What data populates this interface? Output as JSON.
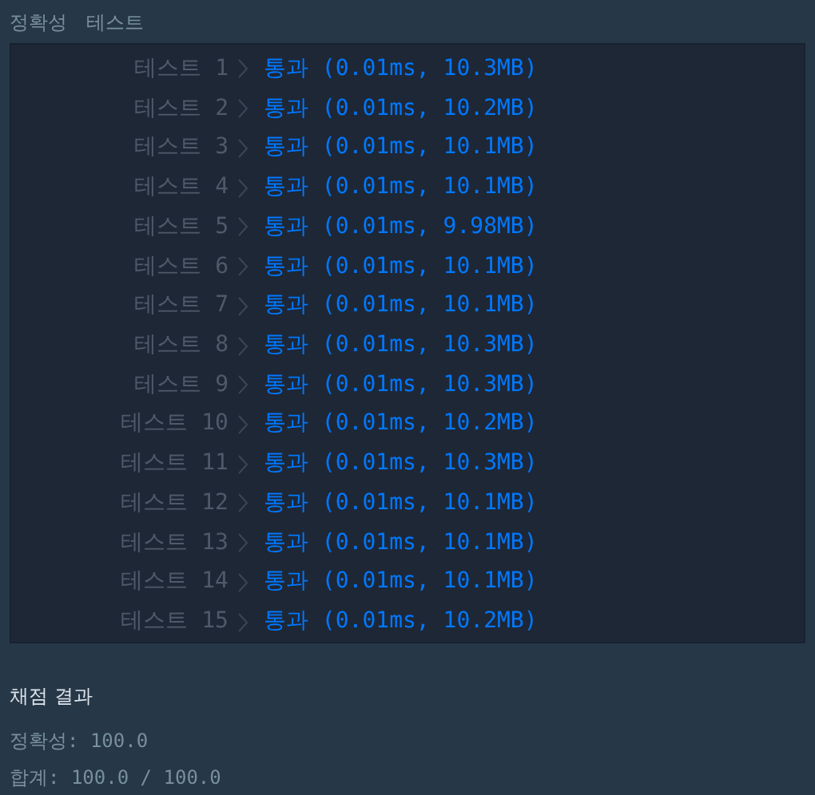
{
  "header": {
    "title": "정확성",
    "subtitle": "테스트"
  },
  "tests": [
    {
      "label": "테스트 1",
      "result": "통과 (0.01ms, 10.3MB)",
      "kind": "pass"
    },
    {
      "label": "테스트 2",
      "result": "통과 (0.01ms, 10.2MB)",
      "kind": "pass"
    },
    {
      "label": "테스트 3",
      "result": "통과 (0.01ms, 10.1MB)",
      "kind": "pass"
    },
    {
      "label": "테스트 4",
      "result": "통과 (0.01ms, 10.1MB)",
      "kind": "pass"
    },
    {
      "label": "테스트 5",
      "result": "통과 (0.01ms, 9.98MB)",
      "kind": "pass"
    },
    {
      "label": "테스트 6",
      "result": "통과 (0.01ms, 10.1MB)",
      "kind": "pass"
    },
    {
      "label": "테스트 7",
      "result": "통과 (0.01ms, 10.1MB)",
      "kind": "pass"
    },
    {
      "label": "테스트 8",
      "result": "통과 (0.01ms, 10.3MB)",
      "kind": "pass"
    },
    {
      "label": "테스트 9",
      "result": "통과 (0.01ms, 10.3MB)",
      "kind": "pass"
    },
    {
      "label": "테스트 10",
      "result": "통과 (0.01ms, 10.2MB)",
      "kind": "pass"
    },
    {
      "label": "테스트 11",
      "result": "통과 (0.01ms, 10.3MB)",
      "kind": "pass"
    },
    {
      "label": "테스트 12",
      "result": "통과 (0.01ms, 10.1MB)",
      "kind": "pass"
    },
    {
      "label": "테스트 13",
      "result": "통과 (0.01ms, 10.1MB)",
      "kind": "pass"
    },
    {
      "label": "테스트 14",
      "result": "통과 (0.01ms, 10.1MB)",
      "kind": "pass"
    },
    {
      "label": "테스트 15",
      "result": "통과 (0.01ms, 10.2MB)",
      "kind": "pass"
    }
  ],
  "summary": {
    "title": "채점 결과",
    "lines": [
      "정확성: 100.0",
      "합계: 100.0 / 100.0"
    ]
  }
}
